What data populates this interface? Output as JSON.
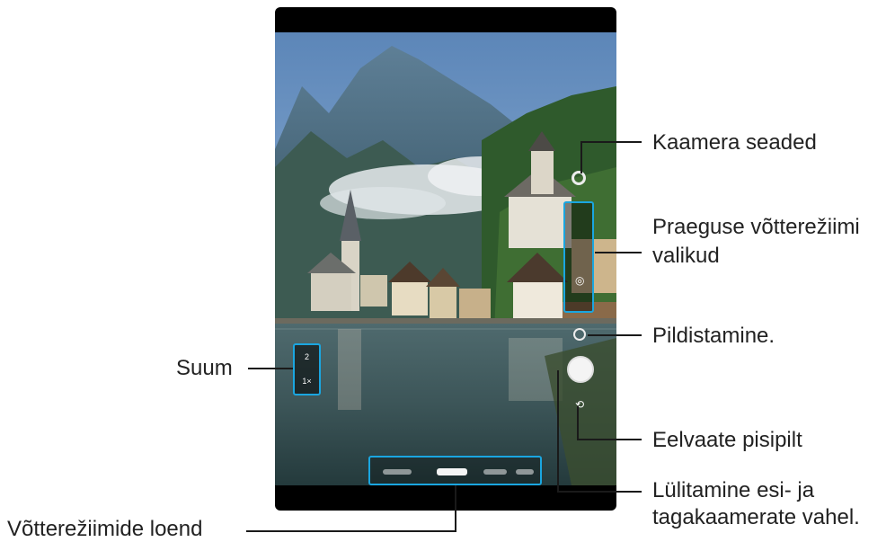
{
  "labels": {
    "camera_settings": "Kaamera seaded",
    "mode_options_line1": "Praeguse võtterežiimi",
    "mode_options_line2": "valikud",
    "take_picture": "Pildistamine.",
    "preview_thumbnail": "Eelvaate pisipilt",
    "switch_cameras_line1": "Lülitamine esi- ja",
    "switch_cameras_line2": "tagakaamerate vahel.",
    "zoom": "Suum",
    "mode_list": "Võtterežiimide loend"
  },
  "zoom_options": [
    "2",
    "1×"
  ],
  "icons": {
    "settings": "gear-icon",
    "shutter": "shutter-button-icon",
    "switch": "switch-camera-icon",
    "thumbnail": "preview-thumbnail-icon"
  },
  "colors": {
    "callout_border": "#1aa6e0",
    "leader_line": "#1a1a1a",
    "label_text": "#222222"
  }
}
